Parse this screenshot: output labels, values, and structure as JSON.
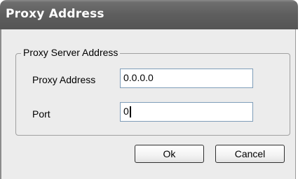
{
  "window": {
    "title": "Proxy Address"
  },
  "group": {
    "legend": "Proxy Server Address"
  },
  "fields": {
    "address_label": "Proxy Address",
    "address_value": "0.0.0.0",
    "port_label": "Port",
    "port_value": "0"
  },
  "buttons": {
    "ok": "Ok",
    "cancel": "Cancel"
  }
}
